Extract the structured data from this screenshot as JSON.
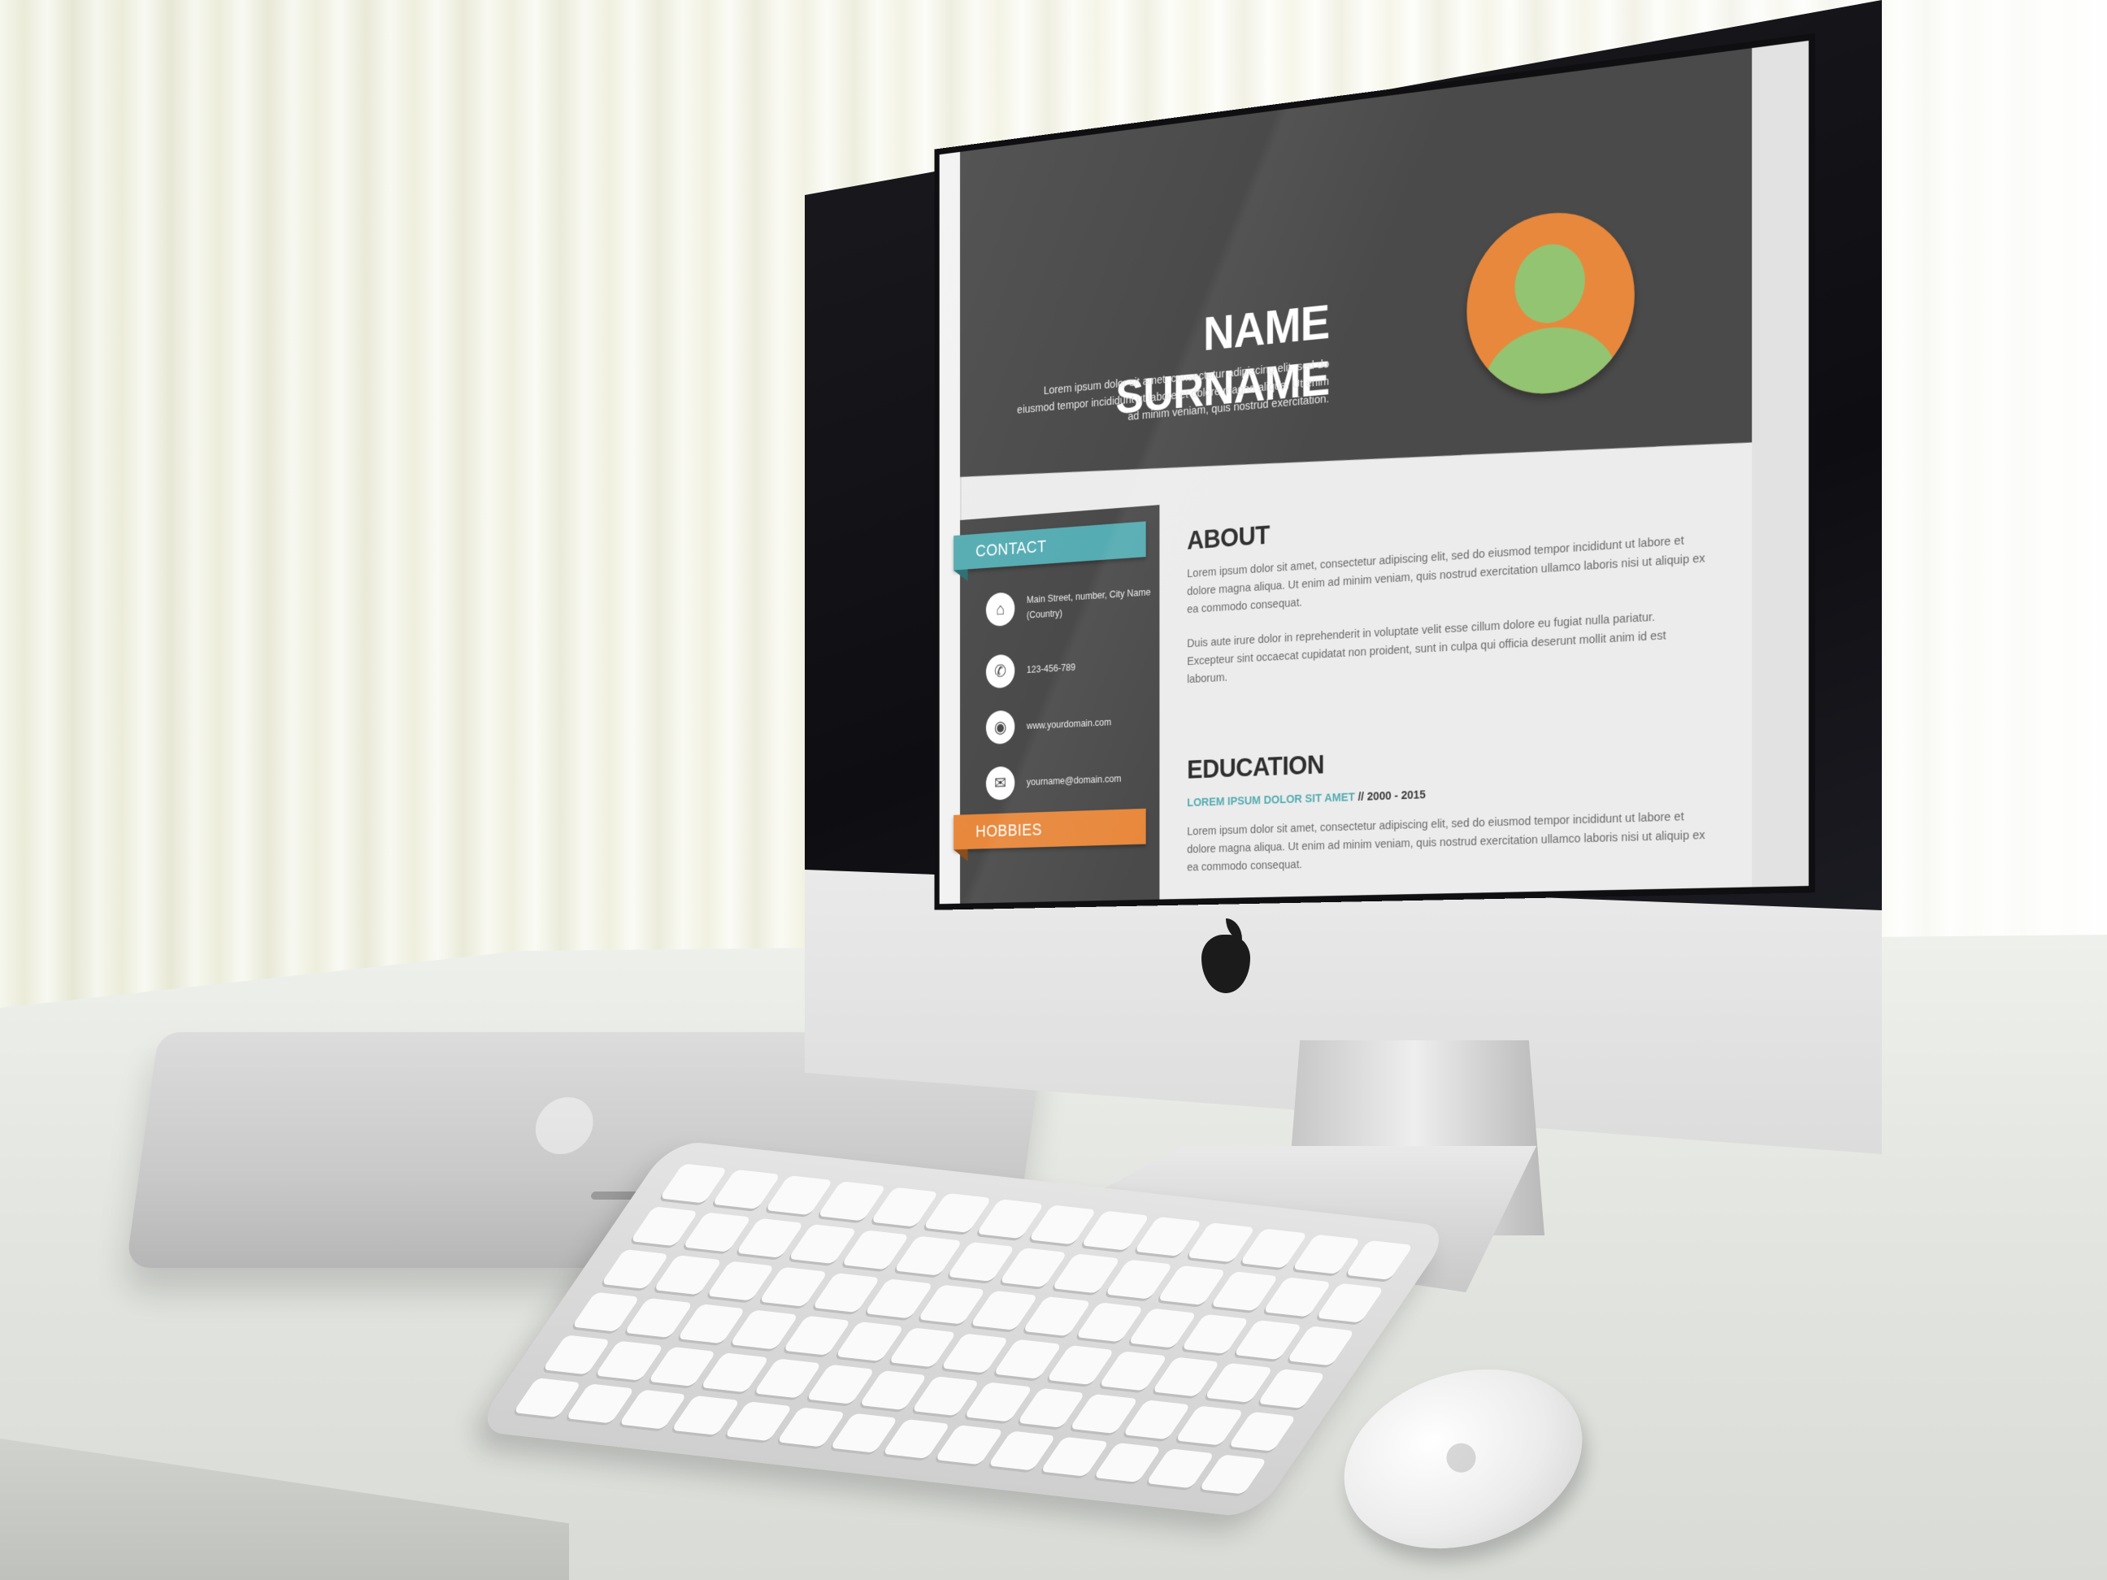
{
  "resume": {
    "name": "NAME SURNAME",
    "bio": "Lorem ipsum dolor sit amet, consectetur adipiscing elit, sed do eiusmod tempor incididunt ut labore et dolore magna aliqua. Ut enim ad minim veniam, quis nostrud exercitation.",
    "avatar_icon": "user-avatar-icon"
  },
  "sidebar": {
    "contact_label": "CONTACT",
    "hobbies_label": "HOBBIES",
    "contacts": [
      {
        "icon": "home-icon",
        "text": "Main Street, number, City Name (Country)"
      },
      {
        "icon": "phone-icon",
        "text": "123-456-789"
      },
      {
        "icon": "globe-icon",
        "text": "www.yourdomain.com"
      },
      {
        "icon": "mail-icon",
        "text": "yourname@domain.com"
      }
    ]
  },
  "about": {
    "title": "ABOUT",
    "p1": "Lorem ipsum dolor sit amet, consectetur adipiscing elit, sed do eiusmod tempor incididunt ut labore et dolore magna aliqua. Ut enim ad minim veniam, quis nostrud exercitation ullamco laboris nisi ut aliquip ex ea commodo consequat.",
    "p2": "Duis aute irure dolor in reprehenderit in voluptate velit esse cillum dolore eu fugiat nulla pariatur. Excepteur sint occaecat cupidatat non proident, sunt in culpa qui officia deserunt mollit anim id est laborum."
  },
  "education": {
    "title": "EDUCATION",
    "school": "LOREM IPSUM DOLOR SIT AMET",
    "separator": " // ",
    "years": "2000 - 2015",
    "p1": "Lorem ipsum dolor sit amet, consectetur adipiscing elit, sed do eiusmod tempor incididunt ut labore et dolore magna aliqua. Ut enim ad minim veniam, quis nostrud exercitation ullamco laboris nisi ut aliquip ex ea commodo consequat."
  },
  "colors": {
    "header": "#4a4a4a",
    "accent_teal": "#55acb2",
    "accent_orange": "#e8883c",
    "avatar_green": "#93c472"
  }
}
